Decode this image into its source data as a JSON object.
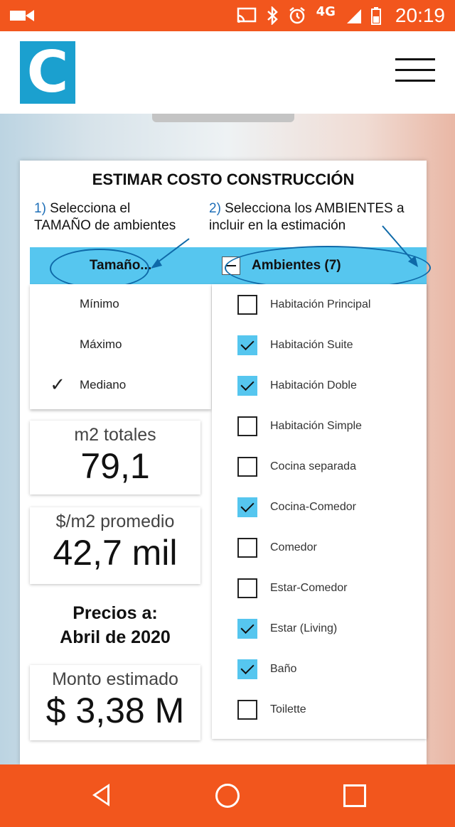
{
  "status_bar": {
    "time": "20:19",
    "network": "4G",
    "icons": [
      "video-call-icon",
      "cast-icon",
      "bluetooth-icon",
      "alarm-icon",
      "signal-icon",
      "battery-icon"
    ]
  },
  "app": {
    "logo_letter": "C",
    "colors": {
      "accent": "#f2561d",
      "brand": "#1ba0cf",
      "highlight": "#56c6ef"
    }
  },
  "card": {
    "title": "ESTIMAR COSTO CONSTRUCCIÓN",
    "instruction1": {
      "num": "1)",
      "line1": " Selecciona el",
      "line2": "TAMAÑO de ambientes"
    },
    "instruction2": {
      "num": "2)",
      "line1": " Selecciona los AMBIENTES a",
      "line2": "incluir en la estimación"
    },
    "size_dropdown": {
      "label": "Tamaño...",
      "options": [
        {
          "label": "Mínimo",
          "selected": false
        },
        {
          "label": "Máximo",
          "selected": false
        },
        {
          "label": "Mediano",
          "selected": true
        }
      ]
    },
    "check_glyph": "✓",
    "stats": {
      "m2": {
        "label": "m2 totales",
        "value": "79,1"
      },
      "price_m2": {
        "label": "$/m2 promedio",
        "value": "42,7 mil"
      }
    },
    "precios": {
      "line1": "Precios a:",
      "line2": "Abril de 2020"
    },
    "monto": {
      "label": "Monto estimado",
      "value": "$ 3,38 M"
    },
    "ambientes": {
      "label": "Ambientes (7)",
      "items": [
        {
          "label": "Habitación Principal",
          "checked": false
        },
        {
          "label": "Habitación Suite",
          "checked": true
        },
        {
          "label": "Habitación Doble",
          "checked": true
        },
        {
          "label": "Habitación Simple",
          "checked": false
        },
        {
          "label": "Cocina separada",
          "checked": false
        },
        {
          "label": "Cocina-Comedor",
          "checked": true
        },
        {
          "label": "Comedor",
          "checked": false
        },
        {
          "label": "Estar-Comedor",
          "checked": false
        },
        {
          "label": "Estar (Living)",
          "checked": true
        },
        {
          "label": "Baño",
          "checked": true
        },
        {
          "label": "Toilette",
          "checked": false
        }
      ]
    }
  }
}
